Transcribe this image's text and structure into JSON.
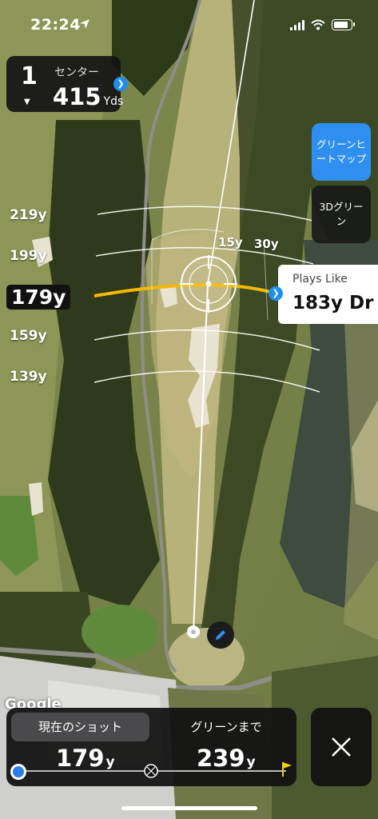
{
  "status": {
    "time": "22:24"
  },
  "hole": {
    "number": "1",
    "position_label": "センター",
    "distance": "415",
    "unit": "Yds"
  },
  "buttons": {
    "heatmap": "グリーンヒートマップ",
    "green_3d": "3Dグリーン"
  },
  "distance_labels": [
    "219y",
    "199y",
    "179y",
    "159y",
    "139y"
  ],
  "active_distance": "179y",
  "wedge_labels": {
    "left": "15y",
    "right": "30y"
  },
  "plays_like": {
    "title": "Plays Like",
    "value": "183y Dr"
  },
  "map_attribution": "Google",
  "bottom": {
    "tab_current": "現在のショット",
    "tab_green": "グリーンまで",
    "current_value": "179",
    "green_value": "239",
    "unit": "y"
  },
  "colors": {
    "accent_blue": "#2f8ff0",
    "aim_line": "#f5b800",
    "panel": "#121212"
  },
  "icons": [
    "location-arrow-icon",
    "signal-icon",
    "wifi-icon",
    "battery-icon",
    "chevron-right-icon",
    "crosshair-icon",
    "pencil-icon",
    "flag-icon",
    "close-icon"
  ]
}
